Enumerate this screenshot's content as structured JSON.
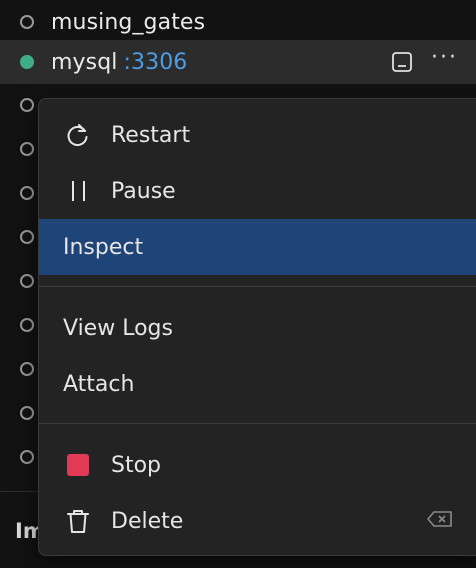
{
  "containers": [
    {
      "name": "musing_gates",
      "port": "",
      "status": "stopped"
    },
    {
      "name": "mysql",
      "port": ":3306",
      "status": "running"
    },
    {
      "name": "",
      "port": "",
      "status": "stopped"
    },
    {
      "name": "",
      "port": "",
      "status": "stopped"
    },
    {
      "name": "",
      "port": "",
      "status": "stopped"
    },
    {
      "name": "",
      "port": "",
      "status": "stopped"
    },
    {
      "name": "",
      "port": "",
      "status": "stopped"
    },
    {
      "name": "",
      "port": "",
      "status": "stopped"
    },
    {
      "name": "",
      "port": "",
      "status": "stopped"
    },
    {
      "name": "",
      "port": "",
      "status": "stopped"
    },
    {
      "name": "",
      "port": "",
      "status": "stopped"
    }
  ],
  "bottom_section": {
    "label": "Im"
  },
  "context_menu": {
    "restart": "Restart",
    "pause": "Pause",
    "inspect": "Inspect",
    "view_logs": "View Logs",
    "attach": "Attach",
    "stop": "Stop",
    "delete": "Delete"
  },
  "colors": {
    "running": "#3fae88",
    "port": "#4b9ee6",
    "highlight": "#1f4477",
    "stop": "#e03a55"
  }
}
